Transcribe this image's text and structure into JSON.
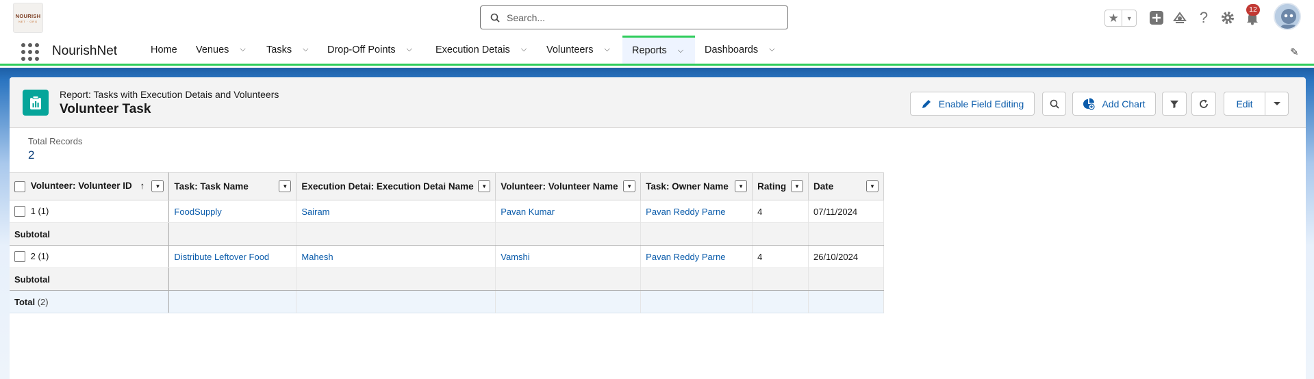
{
  "logo": {
    "line1": "NOURISH",
    "line2": "NET · ORG"
  },
  "search": {
    "placeholder": "Search..."
  },
  "header": {
    "notification_count": "12"
  },
  "app": {
    "name": "NourishNet"
  },
  "nav": {
    "items": [
      {
        "label": "Home"
      },
      {
        "label": "Venues"
      },
      {
        "label": "Tasks"
      },
      {
        "label": "Drop-Off Points"
      },
      {
        "label": "Execution Detais"
      },
      {
        "label": "Volunteers"
      },
      {
        "label": "Reports"
      },
      {
        "label": "Dashboards"
      }
    ],
    "active": "Reports"
  },
  "report": {
    "subtitle": "Report: Tasks with Execution Detais and Volunteers",
    "title": "Volunteer Task",
    "buttons": {
      "enable_field_editing": "Enable Field Editing",
      "add_chart": "Add Chart",
      "edit": "Edit"
    },
    "total_records_label": "Total Records",
    "total_records_value": "2"
  },
  "table": {
    "columns": [
      "Volunteer: Volunteer ID",
      "Task: Task Name",
      "Execution Detai: Execution Detai Name",
      "Volunteer: Volunteer Name",
      "Task: Owner Name",
      "Rating",
      "Date"
    ],
    "sort_indicator": "↑",
    "groups": [
      {
        "group_label": "1 (1)",
        "row": [
          "FoodSupply",
          "Sairam",
          "Pavan Kumar",
          "Pavan Reddy Parne",
          "4",
          "07/11/2024"
        ],
        "subtotal_label": "Subtotal"
      },
      {
        "group_label": "2 (1)",
        "row": [
          "Distribute Leftover Food",
          "Mahesh",
          "Vamshi",
          "Pavan Reddy Parne",
          "4",
          "26/10/2024"
        ],
        "subtotal_label": "Subtotal"
      }
    ],
    "total_label": "Total",
    "total_count": "(2)"
  }
}
